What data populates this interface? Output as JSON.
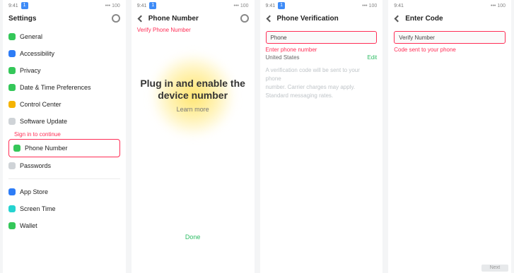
{
  "panels": [
    {
      "status": {
        "time": "9:41",
        "badge": "1",
        "right": "••• 100"
      },
      "header": {
        "title": "Settings"
      },
      "list": [
        {
          "label": "General",
          "color": "green"
        },
        {
          "label": "Accessibility",
          "color": "blue"
        },
        {
          "label": "Privacy",
          "color": "green"
        },
        {
          "label": "Date & Time Preferences",
          "color": "green"
        },
        {
          "label": "Control Center",
          "color": "yellow"
        },
        {
          "label": "Software Update",
          "color": "gray"
        },
        {
          "label": "Phone Number",
          "color": "green",
          "highlight": true
        },
        {
          "label": "Passwords",
          "color": "gray"
        },
        {
          "label": "App Store",
          "color": "blue"
        },
        {
          "label": "Screen Time",
          "color": "cyan"
        },
        {
          "label": "Wallet",
          "color": "green"
        }
      ],
      "red_note": "Sign in to continue"
    },
    {
      "status": {
        "time": "9:41",
        "badge": "1",
        "right": "••• 100"
      },
      "header": {
        "title": "Phone Number"
      },
      "red_note": "Verify Phone Number",
      "big_text_line1": "Plug in and enable the",
      "big_text_line2": "device number",
      "big_sub": "Learn more",
      "green_link": "Done"
    },
    {
      "status": {
        "time": "9:41",
        "badge": "1",
        "right": "••• 100"
      },
      "header": {
        "title": "Phone Verification"
      },
      "input_value": "Phone",
      "red_note": "Enter phone number",
      "row_left": "United States",
      "row_right": "Edit",
      "gray_lines": [
        "A verification code will be sent to your phone",
        "number. Carrier charges may apply.",
        "Standard messaging rates."
      ]
    },
    {
      "status": {
        "time": "9:41",
        "badge": "",
        "right": "••• 100"
      },
      "header": {
        "title": "Enter Code"
      },
      "input_value": "Verify Number",
      "red_note": "Code sent to your phone",
      "bottom_right": "Next"
    }
  ]
}
